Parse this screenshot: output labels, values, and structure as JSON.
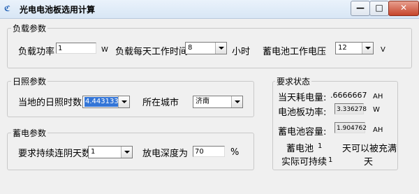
{
  "window": {
    "title": "光电电池板选用计算",
    "icon_glyph": "ℭ",
    "controls": {
      "minimize": "—",
      "maximize": "□",
      "close": "✕"
    }
  },
  "load": {
    "group_label": "负载参数",
    "power_label": "负载功率",
    "power_value": "1",
    "power_unit": "W",
    "hours_label": "负载每天工作时间",
    "hours_value": "8",
    "hours_unit": "小时",
    "voltage_label": "蓄电池工作电压",
    "voltage_value": "12",
    "voltage_unit": "V"
  },
  "sun": {
    "group_label": "日照参数",
    "sunshine_label": "当地的日照时数",
    "sunshine_value": "4.4431332",
    "city_label": "所在城市",
    "city_value": "济南"
  },
  "storage": {
    "group_label": "蓄电参数",
    "days_label": "要求持续连阴天数",
    "days_value": "1",
    "depth_label": "放电深度为",
    "depth_value": "70",
    "depth_unit": "%"
  },
  "status": {
    "group_label": "要求状态",
    "daily_consumption_label": "当天耗电量:",
    "daily_consumption_value": ".6666667",
    "daily_consumption_unit": "AH",
    "panel_power_label": "电池板功率:",
    "panel_power_value": "3.336278",
    "panel_power_unit": "W",
    "battery_capacity_label": "蓄电池容量:",
    "battery_capacity_value": "1.904762",
    "battery_capacity_unit": "AH",
    "battery_label": "蓄电池",
    "battery_value": "1",
    "battery_suffix": "天可以被充满",
    "actual_label": "实际可持续",
    "actual_value": "1",
    "actual_suffix": "天"
  }
}
